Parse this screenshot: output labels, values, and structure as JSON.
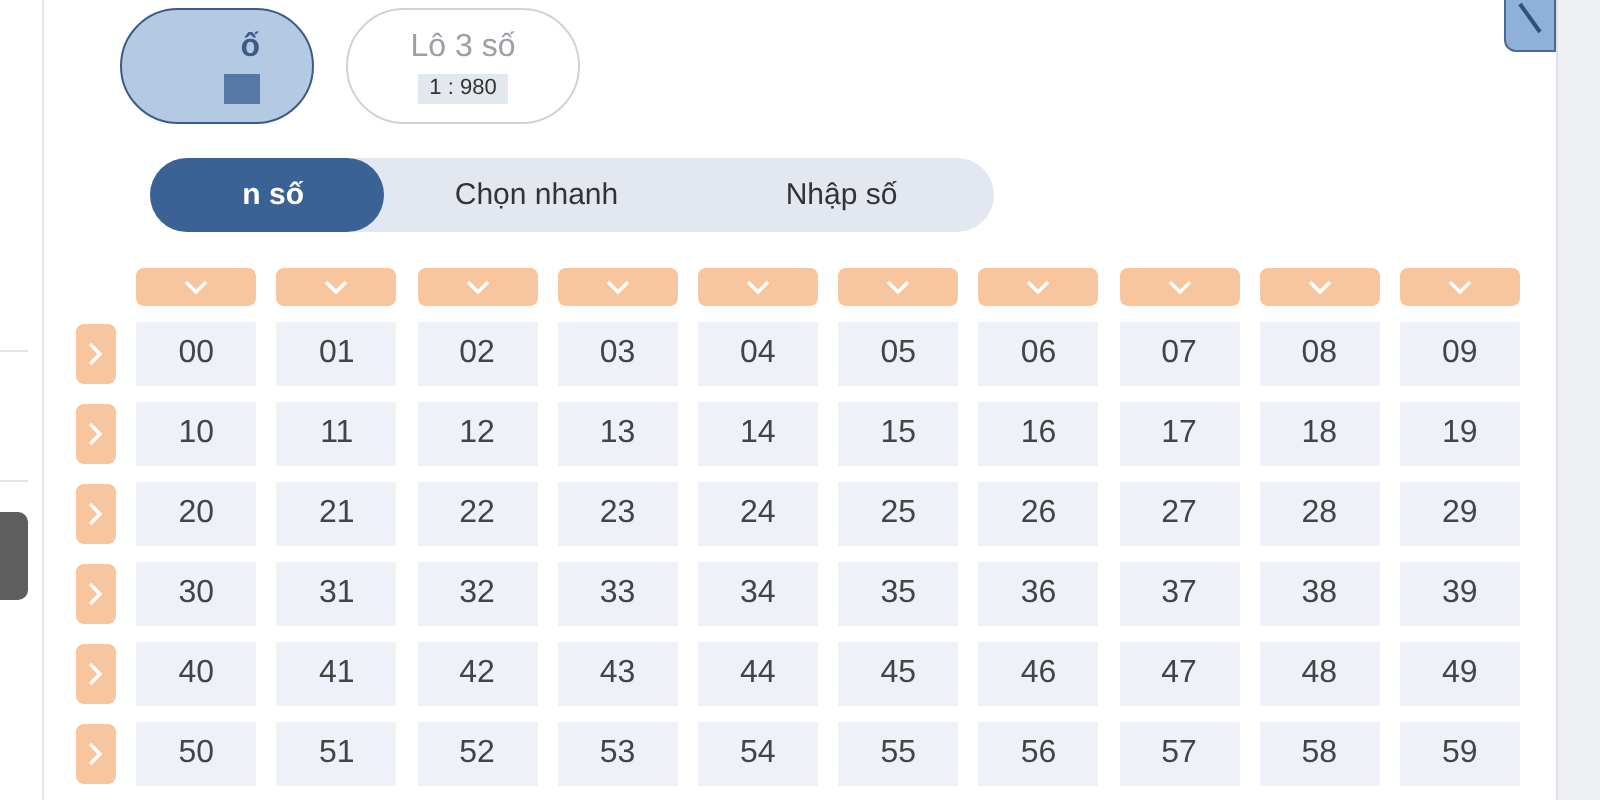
{
  "bet_types": [
    {
      "label": "ố",
      "selected": true
    },
    {
      "label": "Lô 3 số",
      "odds": "1 : 980",
      "selected": false
    }
  ],
  "tabs": [
    {
      "label": "n số",
      "selected": true
    },
    {
      "label": "Chọn nhanh",
      "selected": false
    },
    {
      "label": "Nhập số",
      "selected": false
    }
  ],
  "grid": {
    "rows": [
      [
        "00",
        "01",
        "02",
        "03",
        "04",
        "05",
        "06",
        "07",
        "08",
        "09"
      ],
      [
        "10",
        "11",
        "12",
        "13",
        "14",
        "15",
        "16",
        "17",
        "18",
        "19"
      ],
      [
        "20",
        "21",
        "22",
        "23",
        "24",
        "25",
        "26",
        "27",
        "28",
        "29"
      ],
      [
        "30",
        "31",
        "32",
        "33",
        "34",
        "35",
        "36",
        "37",
        "38",
        "39"
      ],
      [
        "40",
        "41",
        "42",
        "43",
        "44",
        "45",
        "46",
        "47",
        "48",
        "49"
      ],
      [
        "50",
        "51",
        "52",
        "53",
        "54",
        "55",
        "56",
        "57",
        "58",
        "59"
      ]
    ]
  }
}
